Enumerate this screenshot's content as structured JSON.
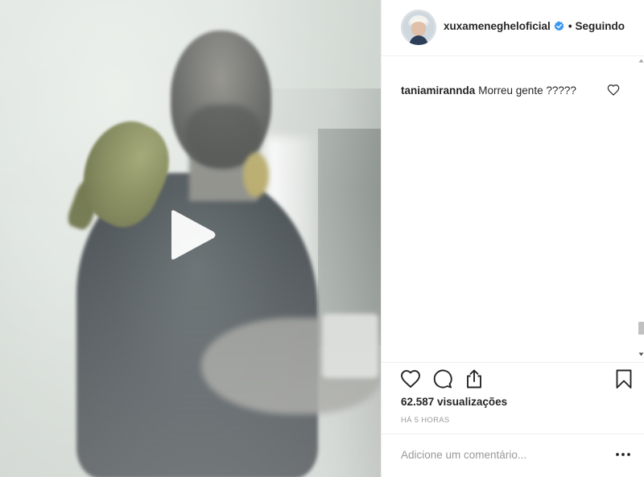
{
  "post": {
    "author": {
      "username": "xuxamenegheloficial",
      "verified": true,
      "follow_status": "Seguindo",
      "separator": "•"
    },
    "comments": [
      {
        "username": "taniamirannda",
        "text": "Morreu gente ?????"
      }
    ],
    "views": "62.587 visualizações",
    "timestamp": "HÁ 5 HORAS",
    "add_comment": {
      "placeholder": "Adicione um comentário..."
    }
  },
  "icons": {
    "play": "play-icon",
    "verified": "verified-badge-icon",
    "comment_like": "heart-outline-icon",
    "like": "heart-outline-icon",
    "comment": "speech-bubble-icon",
    "share": "share-icon",
    "save": "bookmark-icon",
    "more": "ellipsis-icon"
  },
  "colors": {
    "text": "#262626",
    "muted": "#999999",
    "verified": "#3897f0",
    "border": "#efefef"
  }
}
